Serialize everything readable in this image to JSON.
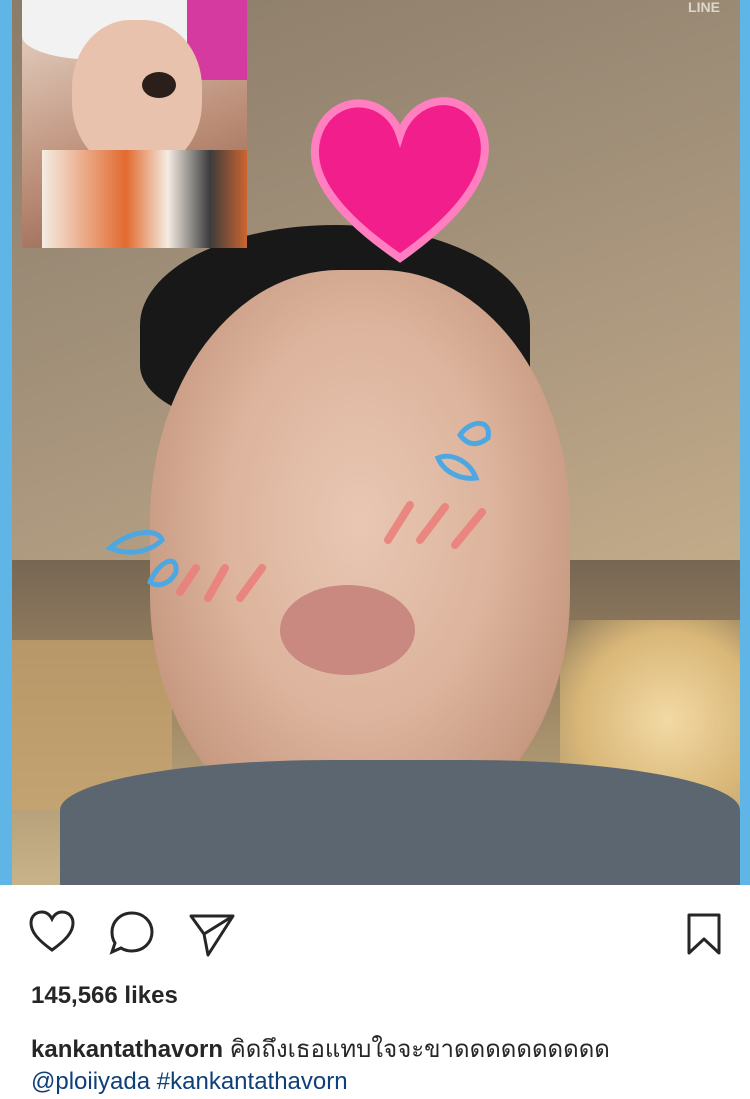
{
  "post": {
    "likes_text": "145,566 likes",
    "username": "kankantathavorn",
    "caption_text": "คิดถึงเธอแทบใจจะขาดดดดดดดดดด",
    "mention": "@ploiiyada",
    "hashtag": "#kankantathavorn",
    "watermark": "LINE"
  },
  "icons": {
    "like": "heart-icon",
    "comment": "comment-bubble-icon",
    "share": "send-paper-plane-icon",
    "save": "bookmark-icon"
  },
  "colors": {
    "frame": "#5fb6e6",
    "heart_sticker": "#f21e8c",
    "text": "#262626",
    "link": "#0d3f7a"
  }
}
